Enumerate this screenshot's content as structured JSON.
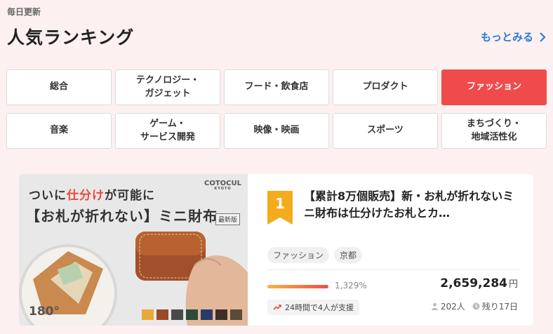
{
  "header": {
    "eyebrow": "毎日更新",
    "title": "人気ランキング",
    "more_label": "もっとみる"
  },
  "categories": [
    {
      "label": "総合",
      "active": false
    },
    {
      "label": "テクノロジー・\nガジェット",
      "active": false
    },
    {
      "label": "フード・飲食店",
      "active": false
    },
    {
      "label": "プロダクト",
      "active": false
    },
    {
      "label": "ファッション",
      "active": true
    },
    {
      "label": "音楽",
      "active": false
    },
    {
      "label": "ゲーム・\nサービス開発",
      "active": false
    },
    {
      "label": "映像・映画",
      "active": false
    },
    {
      "label": "スポーツ",
      "active": false
    },
    {
      "label": "まちづくり・\n地域活性化",
      "active": false
    }
  ],
  "project": {
    "rank": "1",
    "title": "【累計8万個販売】新・お札が折れないミニ財布は仕分けたお札とカ…",
    "tags": [
      "ファッション",
      "京都"
    ],
    "progress_pct": "1,329%",
    "amount": "2,659,284",
    "currency": "円",
    "trend": "24時間で4人が支援",
    "supporters": "202人",
    "remaining": "残り17日",
    "image": {
      "line1_pre": "ついに",
      "line1_hl": "仕分け",
      "line1_mid": "が",
      "line1_post": "可能に",
      "line2": "【お札が折れない】ミニ財布",
      "edition": "最新版",
      "brand": "COTOCUL",
      "brand_sub": "KYOTO",
      "rotation": "180°",
      "swatches": [
        "#e8a93a",
        "#9a4a2a",
        "#4a4a4a",
        "#2f4a3a",
        "#2a3a6a",
        "#3a3028",
        "#5a4a3a"
      ]
    }
  },
  "colors": {
    "accent": "#ef4b4b",
    "link": "#2e7bd6",
    "rank_gold": "#f3ac1c"
  }
}
